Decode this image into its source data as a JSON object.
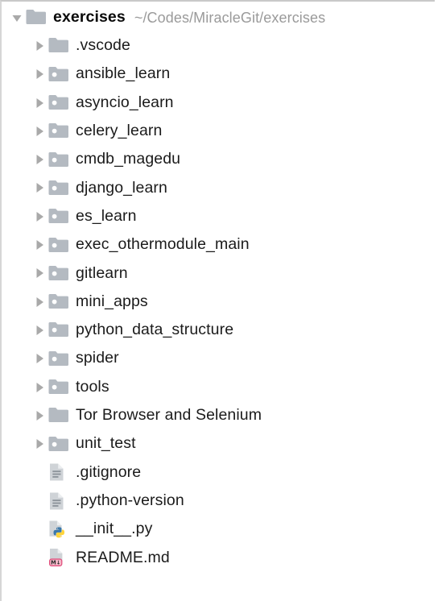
{
  "panel": {
    "name": "project-tool-window",
    "colors": {
      "background": "#ffffff",
      "folder": "#b4bac1",
      "folder_dot": "#ffffff",
      "arrow": "#a9a9a9",
      "text": "#1b1b1b",
      "path_text": "#9a9a9a",
      "file_page": "#c3c7cb",
      "markdown_badge": "#f4b8c8",
      "markdown_badge_border": "#e04a7a",
      "python_blue": "#3c78aa",
      "python_yellow": "#ffd43b"
    }
  },
  "root": {
    "label": "exercises",
    "path": "~/Codes/MiracleGit/exercises",
    "expanded": true,
    "icon": "folder-icon",
    "twisty": "triangle-down-icon"
  },
  "children": [
    {
      "label": ".vscode",
      "icon": "folder-icon",
      "twisty": "triangle-right-icon",
      "expanded": false,
      "type": "folder"
    },
    {
      "label": "ansible_learn",
      "icon": "module-folder-icon",
      "twisty": "triangle-right-icon",
      "expanded": false,
      "type": "module"
    },
    {
      "label": "asyncio_learn",
      "icon": "module-folder-icon",
      "twisty": "triangle-right-icon",
      "expanded": false,
      "type": "module"
    },
    {
      "label": "celery_learn",
      "icon": "module-folder-icon",
      "twisty": "triangle-right-icon",
      "expanded": false,
      "type": "module"
    },
    {
      "label": "cmdb_magedu",
      "icon": "module-folder-icon",
      "twisty": "triangle-right-icon",
      "expanded": false,
      "type": "module"
    },
    {
      "label": "django_learn",
      "icon": "module-folder-icon",
      "twisty": "triangle-right-icon",
      "expanded": false,
      "type": "module"
    },
    {
      "label": "es_learn",
      "icon": "module-folder-icon",
      "twisty": "triangle-right-icon",
      "expanded": false,
      "type": "module"
    },
    {
      "label": "exec_othermodule_main",
      "icon": "module-folder-icon",
      "twisty": "triangle-right-icon",
      "expanded": false,
      "type": "module"
    },
    {
      "label": "gitlearn",
      "icon": "module-folder-icon",
      "twisty": "triangle-right-icon",
      "expanded": false,
      "type": "module"
    },
    {
      "label": "mini_apps",
      "icon": "module-folder-icon",
      "twisty": "triangle-right-icon",
      "expanded": false,
      "type": "module"
    },
    {
      "label": "python_data_structure",
      "icon": "module-folder-icon",
      "twisty": "triangle-right-icon",
      "expanded": false,
      "type": "module"
    },
    {
      "label": "spider",
      "icon": "module-folder-icon",
      "twisty": "triangle-right-icon",
      "expanded": false,
      "type": "module"
    },
    {
      "label": "tools",
      "icon": "module-folder-icon",
      "twisty": "triangle-right-icon",
      "expanded": false,
      "type": "module"
    },
    {
      "label": "Tor Browser and Selenium",
      "icon": "folder-icon",
      "twisty": "triangle-right-icon",
      "expanded": false,
      "type": "folder"
    },
    {
      "label": "unit_test",
      "icon": "module-folder-icon",
      "twisty": "triangle-right-icon",
      "expanded": false,
      "type": "module"
    },
    {
      "label": ".gitignore",
      "icon": "text-file-icon",
      "twisty": null,
      "type": "file"
    },
    {
      "label": ".python-version",
      "icon": "text-file-icon",
      "twisty": null,
      "type": "file"
    },
    {
      "label": "__init__.py",
      "icon": "python-file-icon",
      "twisty": null,
      "type": "file"
    },
    {
      "label": "README.md",
      "icon": "markdown-file-icon",
      "twisty": null,
      "type": "file"
    }
  ]
}
